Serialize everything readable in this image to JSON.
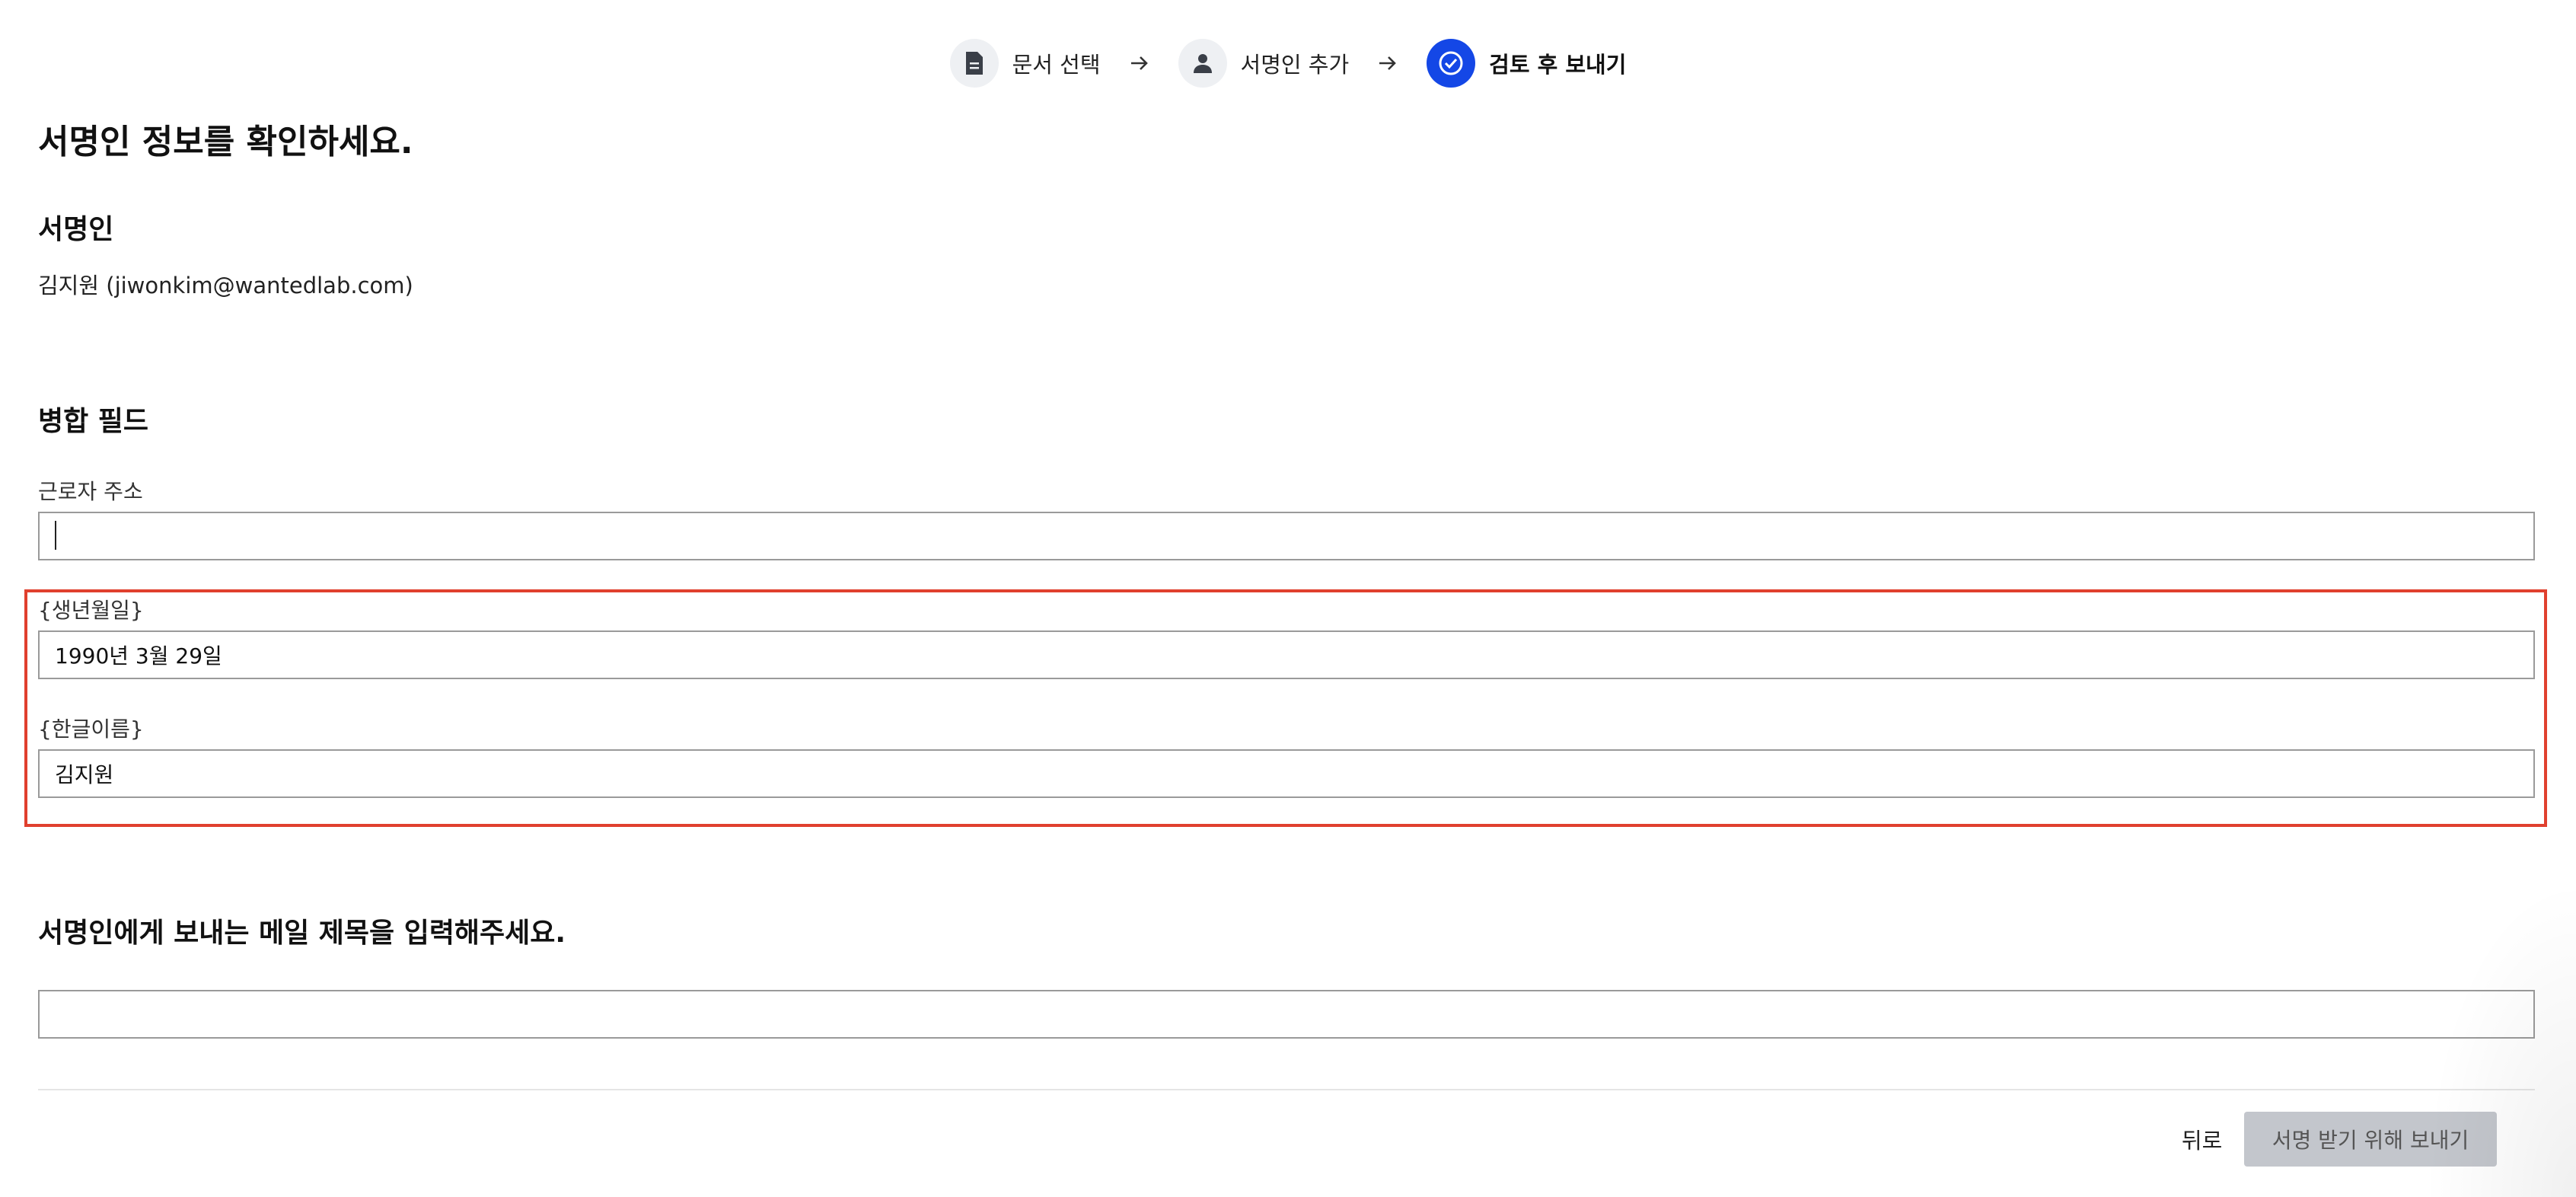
{
  "stepper": {
    "steps": [
      {
        "label": "문서 선택",
        "icon": "document-icon",
        "active": false
      },
      {
        "label": "서명인 추가",
        "icon": "person-icon",
        "active": false
      },
      {
        "label": "검토 후 보내기",
        "icon": "check-icon",
        "active": true
      }
    ]
  },
  "page": {
    "title": "서명인 정보를 확인하세요."
  },
  "signer": {
    "heading": "서명인",
    "value": "김지원 (jiwonkim@wantedlab.com)"
  },
  "merge_fields": {
    "heading": "병합 필드",
    "fields": [
      {
        "label": "근로자 주소",
        "value": ""
      },
      {
        "label": "{생년월일}",
        "value": "1990년 3월 29일"
      },
      {
        "label": "{한글이름}",
        "value": "김지원"
      }
    ]
  },
  "email": {
    "heading": "서명인에게 보내는 메일 제목을 입력해주세요.",
    "value": ""
  },
  "footer": {
    "back_label": "뒤로",
    "send_label": "서명 받기 위해 보내기"
  },
  "colors": {
    "accent": "#1447e6",
    "highlight_border": "#e0402e",
    "disabled_button": "#c3c6cc"
  }
}
